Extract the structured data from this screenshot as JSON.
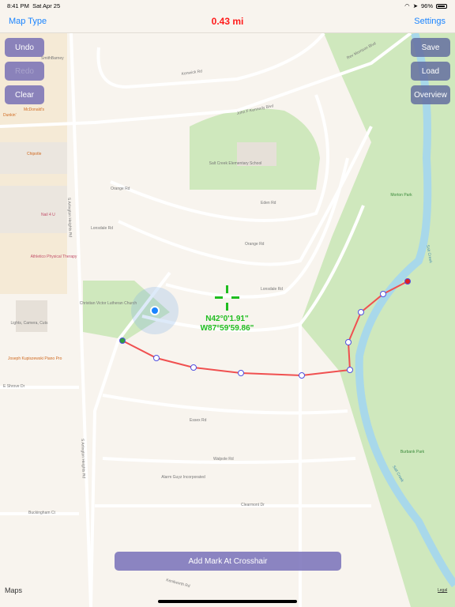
{
  "status": {
    "time": "8:41 PM",
    "date": "Sat Apr 25",
    "battery": "96%",
    "battery_level": 0.96
  },
  "nav": {
    "left": "Map Type",
    "title": "0.43 mi",
    "right": "Settings"
  },
  "buttons": {
    "undo": "Undo",
    "redo": "Redo",
    "clear": "Clear",
    "save": "Save",
    "load": "Load",
    "overview": "Overview",
    "add_mark": "Add Mark At Crosshair"
  },
  "crosshair": {
    "lat": "N42°0'1.91\"",
    "lon": "W87°59'59.86\""
  },
  "route": {
    "start_color": "#2e9e3a",
    "end_color": "#e02020",
    "line_color": "#f05050"
  },
  "map_labels": {
    "kenwick": "Kenwick Rd",
    "jfk": "John F Kennedy Blvd",
    "rev": "Rev Morrison Blvd",
    "school": "Salt Creek Elementary School",
    "morton": "Morton Park",
    "burbank": "Burbank Park",
    "creek1": "Salt Creek",
    "creek2": "Salt Creek",
    "arlington1": "S Arlington Heights Rd",
    "arlington2": "S Arlington Heights Rd",
    "lonsdale1": "Lonsdale Rd",
    "lonsdale2": "Lonsdale Rd",
    "orange1": "Orange Rd",
    "orange2": "Orange Rd",
    "essex": "Essex Rd",
    "walpole": "Walpole Rd",
    "clearmont": "Clearmont Dr",
    "buckingham": "Buckingham Ct",
    "kenilworth": "Kenilworth Rd",
    "church": "Christian Victor Lutheran Church",
    "athletico": "Athletico Physical Therapy",
    "nail": "Nail 4 U",
    "chipotle": "Chipotle",
    "mcd": "McDonald's",
    "dunkin": "Dunkin'",
    "smith": "SmithBarney",
    "piano": "Joseph Kupiszewski Piano Pro",
    "alarm": "Alarm Guyz Incorporated",
    "lights": "Lights, Camera, Cuts",
    "shrove": "E Shrove Dr",
    "eden": "Eden Rd"
  },
  "maps_logo": "Maps",
  "legal": "Legal"
}
